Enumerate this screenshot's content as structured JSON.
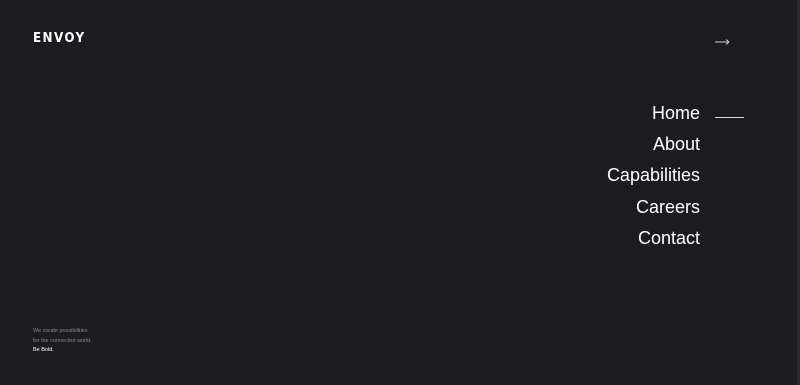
{
  "brand": {
    "logo_text": "ENVOY"
  },
  "header": {
    "menu_toggle_icon": "arrow-right-icon"
  },
  "nav": {
    "items": [
      {
        "label": "Home",
        "active": true
      },
      {
        "label": "About",
        "active": false
      },
      {
        "label": "Capabilities",
        "active": false
      },
      {
        "label": "Careers",
        "active": false
      },
      {
        "label": "Contact",
        "active": false
      }
    ]
  },
  "footer": {
    "line1": "We create possibilities",
    "line2": "for the connected world.",
    "line3": "Be Bold."
  },
  "colors": {
    "background": "#1c1c1e",
    "text": "#ffffff",
    "muted_text": "#8a8a8e",
    "accent_line": "#d8d8d8"
  }
}
